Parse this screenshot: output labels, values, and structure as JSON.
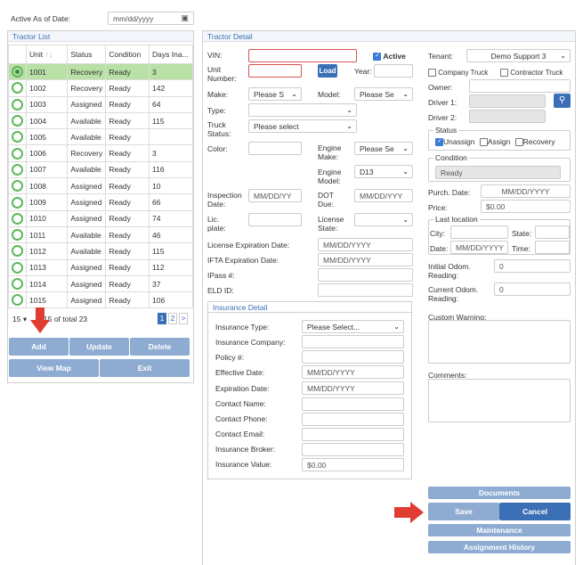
{
  "top": {
    "active_as_of_label": "Active As of Date:",
    "date_placeholder": "mm/dd/yyyy"
  },
  "tractor_list": {
    "title": "Tractor List",
    "columns": [
      "Unit",
      "Status",
      "Condition",
      "Days Ina..."
    ],
    "rows": [
      {
        "unit": "1001",
        "status": "Recovery",
        "condition": "Ready",
        "days": "3",
        "selected": true
      },
      {
        "unit": "1002",
        "status": "Recovery",
        "condition": "Ready",
        "days": "142"
      },
      {
        "unit": "1003",
        "status": "Assigned",
        "condition": "Ready",
        "days": "64"
      },
      {
        "unit": "1004",
        "status": "Available",
        "condition": "Ready",
        "days": "115"
      },
      {
        "unit": "1005",
        "status": "Available",
        "condition": "Ready",
        "days": ""
      },
      {
        "unit": "1006",
        "status": "Recovery",
        "condition": "Ready",
        "days": "3"
      },
      {
        "unit": "1007",
        "status": "Available",
        "condition": "Ready",
        "days": "116"
      },
      {
        "unit": "1008",
        "status": "Assigned",
        "condition": "Ready",
        "days": "10"
      },
      {
        "unit": "1009",
        "status": "Assigned",
        "condition": "Ready",
        "days": "66"
      },
      {
        "unit": "1010",
        "status": "Assigned",
        "condition": "Ready",
        "days": "74"
      },
      {
        "unit": "1011",
        "status": "Available",
        "condition": "Ready",
        "days": "46"
      },
      {
        "unit": "1012",
        "status": "Available",
        "condition": "Ready",
        "days": "115"
      },
      {
        "unit": "1013",
        "status": "Assigned",
        "condition": "Ready",
        "days": "112"
      },
      {
        "unit": "1014",
        "status": "Assigned",
        "condition": "Ready",
        "days": "37"
      },
      {
        "unit": "1015",
        "status": "Assigned",
        "condition": "Ready",
        "days": "106"
      }
    ],
    "page_size": "15",
    "paging_text": "15 of total 23",
    "pages": [
      "1",
      "2"
    ],
    "next_symbol": ">",
    "buttons": {
      "add": "Add",
      "update": "Update",
      "delete": "Delete",
      "view_map": "View Map",
      "exit": "Exit"
    }
  },
  "detail": {
    "title": "Tractor Detail",
    "vin_label": "VIN:",
    "active_label": "Active",
    "unit_number_label": "Unit Number:",
    "load_label": "Load",
    "year_label": "Year:",
    "make_label": "Make:",
    "make_value": "Please S",
    "model_label": "Model:",
    "model_value": "Please Se",
    "type_label": "Type:",
    "truck_status_label": "Truck Status:",
    "truck_status_value": "Please select",
    "color_label": "Color:",
    "engine_make_label": "Engine Make:",
    "engine_make_value": "Please Se",
    "engine_model_label": "Engine Model:",
    "engine_model_value": "D13",
    "inspection_label": "Inspection Date:",
    "inspection_placeholder": "MM/DD/YY",
    "dot_due_label": "DOT Due:",
    "dot_due_placeholder": "MM/DD/YYY",
    "lic_plate_label": "Lic. plate:",
    "license_state_label": "License State:",
    "license_exp_label": "License Expiration Date:",
    "license_exp_placeholder": "MM/DD/YYYY",
    "ifta_exp_label": "IFTA Expiration Date:",
    "ifta_exp_placeholder": "MM/DD/YYYY",
    "ipass_label": "IPass #:",
    "eld_label": "ELD ID:"
  },
  "insurance": {
    "title": "Insurance Detail",
    "type_label": "Insurance Type:",
    "type_value": "Please Select...",
    "company_label": "Insurance Company:",
    "policy_label": "Policy #:",
    "effective_label": "Effective Date:",
    "effective_placeholder": "MM/DD/YYYY",
    "expiration_label": "Expiration Date:",
    "expiration_placeholder": "MM/DD/YYYY",
    "contact_name_label": "Contact Name:",
    "contact_phone_label": "Contact Phone:",
    "contact_email_label": "Contact Email:",
    "broker_label": "Insurance Broker:",
    "value_label": "Insurance Value:",
    "value_value": "$0.00"
  },
  "right": {
    "tenant_label": "Tenant:",
    "tenant_value": "Demo Support 3",
    "company_truck_label": "Company Truck",
    "contractor_truck_label": "Contractor Truck",
    "owner_label": "Owner:",
    "driver1_label": "Driver 1:",
    "driver2_label": "Driver 2:",
    "status_title": "Status",
    "unassign_label": "Unassign",
    "assign_label": "Assign",
    "recovery_label": "Recovery",
    "condition_title": "Condition",
    "condition_value": "Ready",
    "purch_date_label": "Purch. Date:",
    "purch_date_placeholder": "MM/DD/YYYY",
    "price_label": "Price:",
    "price_value": "$0.00",
    "last_location_title": "Last location",
    "city_label": "City:",
    "state_label": "State:",
    "date_label": "Date:",
    "date_placeholder": "MM/DD/YYYY",
    "time_label": "Time:",
    "initial_odom_label": "Initial Odom. Reading:",
    "initial_odom_value": "0",
    "current_odom_label": "Current Odom. Reading:",
    "current_odom_value": "0",
    "custom_warning_label": "Custom Warning:",
    "comments_label": "Comments:"
  },
  "actions": {
    "documents": "Documents",
    "save": "Save",
    "cancel": "Cancel",
    "maintenance": "Maintenance",
    "assignment_history": "Assignment History"
  },
  "colors": {
    "accent": "#3a6fb5",
    "button_light": "#8eacd2",
    "selected_row": "#b9e0a5",
    "annotation_arrow": "#e03c31"
  }
}
